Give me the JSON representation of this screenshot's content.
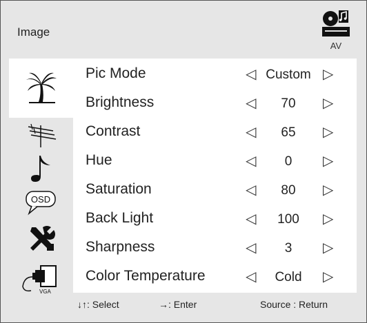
{
  "header": {
    "title": "Image",
    "source_label": "AV",
    "source_icon": "av-source-icon"
  },
  "sidebar": {
    "items": [
      {
        "name": "picture",
        "icon": "palm-tree-icon",
        "active": true
      },
      {
        "name": "channel",
        "icon": "antenna-icon",
        "active": false
      },
      {
        "name": "sound",
        "icon": "music-note-icon",
        "active": false
      },
      {
        "name": "osd",
        "icon": "osd-bubble-icon",
        "label": "OSD",
        "active": false
      },
      {
        "name": "setup",
        "icon": "tools-icon",
        "active": false
      },
      {
        "name": "vga",
        "icon": "vga-connector-icon",
        "label": "VGA",
        "active": false
      }
    ]
  },
  "menu": {
    "rows": [
      {
        "label": "Pic Mode",
        "value": "Custom"
      },
      {
        "label": "Brightness",
        "value": "70"
      },
      {
        "label": "Contrast",
        "value": "65"
      },
      {
        "label": "Hue",
        "value": "0"
      },
      {
        "label": "Saturation",
        "value": "80"
      },
      {
        "label": "Back Light",
        "value": "100"
      },
      {
        "label": "Sharpness",
        "value": "3"
      },
      {
        "label": "Color Temperature",
        "value": "Cold"
      }
    ],
    "arrow_left": "◁",
    "arrow_right": "▷"
  },
  "footer": {
    "select_hint": "↓↑: Select",
    "enter_hint": "→: Enter",
    "return_hint": "Source : Return"
  },
  "colors": {
    "panel_background": "#e6e6e6",
    "content_background": "#ffffff",
    "text": "#222222"
  }
}
